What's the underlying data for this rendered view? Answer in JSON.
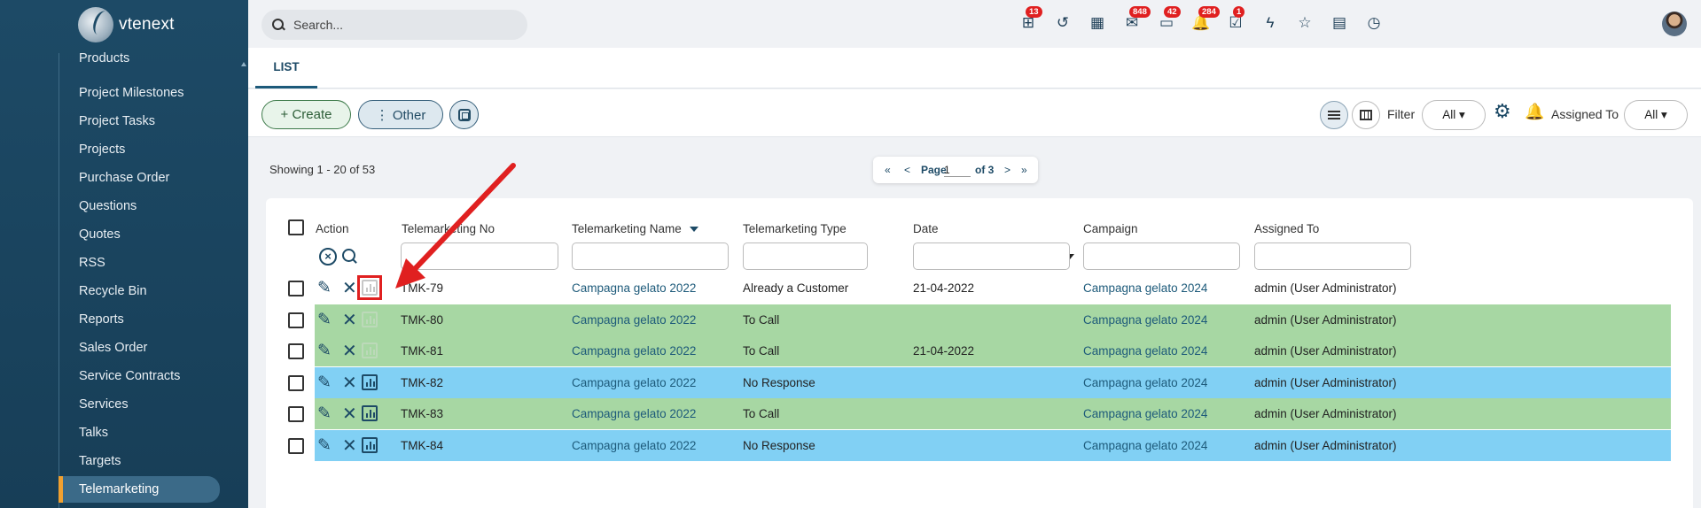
{
  "app": {
    "logo_text": "vtenext"
  },
  "sidebar": {
    "items": [
      {
        "label": "Products",
        "active": false
      },
      {
        "label": "Project Milestones",
        "active": false
      },
      {
        "label": "Project Tasks",
        "active": false
      },
      {
        "label": "Projects",
        "active": false
      },
      {
        "label": "Purchase Order",
        "active": false
      },
      {
        "label": "Questions",
        "active": false
      },
      {
        "label": "Quotes",
        "active": false
      },
      {
        "label": "RSS",
        "active": false
      },
      {
        "label": "Recycle Bin",
        "active": false
      },
      {
        "label": "Reports",
        "active": false
      },
      {
        "label": "Sales Order",
        "active": false
      },
      {
        "label": "Service Contracts",
        "active": false
      },
      {
        "label": "Services",
        "active": false
      },
      {
        "label": "Talks",
        "active": false
      },
      {
        "label": "Targets",
        "active": false
      },
      {
        "label": "Telemarketing",
        "active": true
      }
    ]
  },
  "topbar": {
    "search_placeholder": "Search...",
    "icons": [
      {
        "name": "hierarchy-icon",
        "badge": "13"
      },
      {
        "name": "history-icon",
        "badge": ""
      },
      {
        "name": "calendar-icon",
        "badge": ""
      },
      {
        "name": "mail-icon",
        "badge": "848"
      },
      {
        "name": "chat-icon",
        "badge": "42"
      },
      {
        "name": "notification-bell-icon",
        "badge": "284"
      },
      {
        "name": "task-check-icon",
        "badge": "1"
      },
      {
        "name": "lightning-icon",
        "badge": ""
      },
      {
        "name": "star-icon",
        "badge": ""
      },
      {
        "name": "document-icon",
        "badge": ""
      },
      {
        "name": "stopwatch-icon",
        "badge": ""
      }
    ]
  },
  "tabs": {
    "list_label": "LIST"
  },
  "toolbar": {
    "create_label": "+ Create",
    "other_label": "⋮ Other",
    "filter_label": "Filter",
    "filter_value": "All ▾",
    "assigned_label": "Assigned To",
    "assigned_value": "All ▾"
  },
  "listing": {
    "showing": "Showing 1 - 20 of 53",
    "pager": {
      "first": "«",
      "prev": "<",
      "page_label": "Page",
      "page_value": "1",
      "of_label": "of 3",
      "next": ">",
      "last": "»"
    }
  },
  "table": {
    "columns": {
      "action": "Action",
      "number": "Telemarketing No",
      "name": "Telemarketing Name",
      "type": "Telemarketing Type",
      "date": "Date",
      "campaign": "Campaign",
      "assigned": "Assigned To"
    },
    "rows": [
      {
        "no": "TMK-79",
        "name": "Campagna gelato 2022",
        "type": "Already a Customer",
        "date": "21-04-2022",
        "campaign": "Campagna gelato 2024",
        "assigned": "admin (User Administrator)",
        "color": "white",
        "chart_enabled": false
      },
      {
        "no": "TMK-80",
        "name": "Campagna gelato 2022",
        "type": "To Call",
        "date": "",
        "campaign": "Campagna gelato 2024",
        "assigned": "admin (User Administrator)",
        "color": "green",
        "chart_enabled": false
      },
      {
        "no": "TMK-81",
        "name": "Campagna gelato 2022",
        "type": "To Call",
        "date": "21-04-2022",
        "campaign": "Campagna gelato 2024",
        "assigned": "admin (User Administrator)",
        "color": "green",
        "chart_enabled": false
      },
      {
        "no": "TMK-82",
        "name": "Campagna gelato 2022",
        "type": "No Response",
        "date": "",
        "campaign": "Campagna gelato 2024",
        "assigned": "admin (User Administrator)",
        "color": "blue",
        "chart_enabled": true
      },
      {
        "no": "TMK-83",
        "name": "Campagna gelato 2022",
        "type": "To Call",
        "date": "",
        "campaign": "Campagna gelato 2024",
        "assigned": "admin (User Administrator)",
        "color": "green",
        "chart_enabled": true
      },
      {
        "no": "TMK-84",
        "name": "Campagna gelato 2022",
        "type": "No Response",
        "date": "",
        "campaign": "Campagna gelato 2024",
        "assigned": "admin (User Administrator)",
        "color": "blue",
        "chart_enabled": true
      }
    ]
  },
  "annotation": {
    "color": "#e02020"
  }
}
